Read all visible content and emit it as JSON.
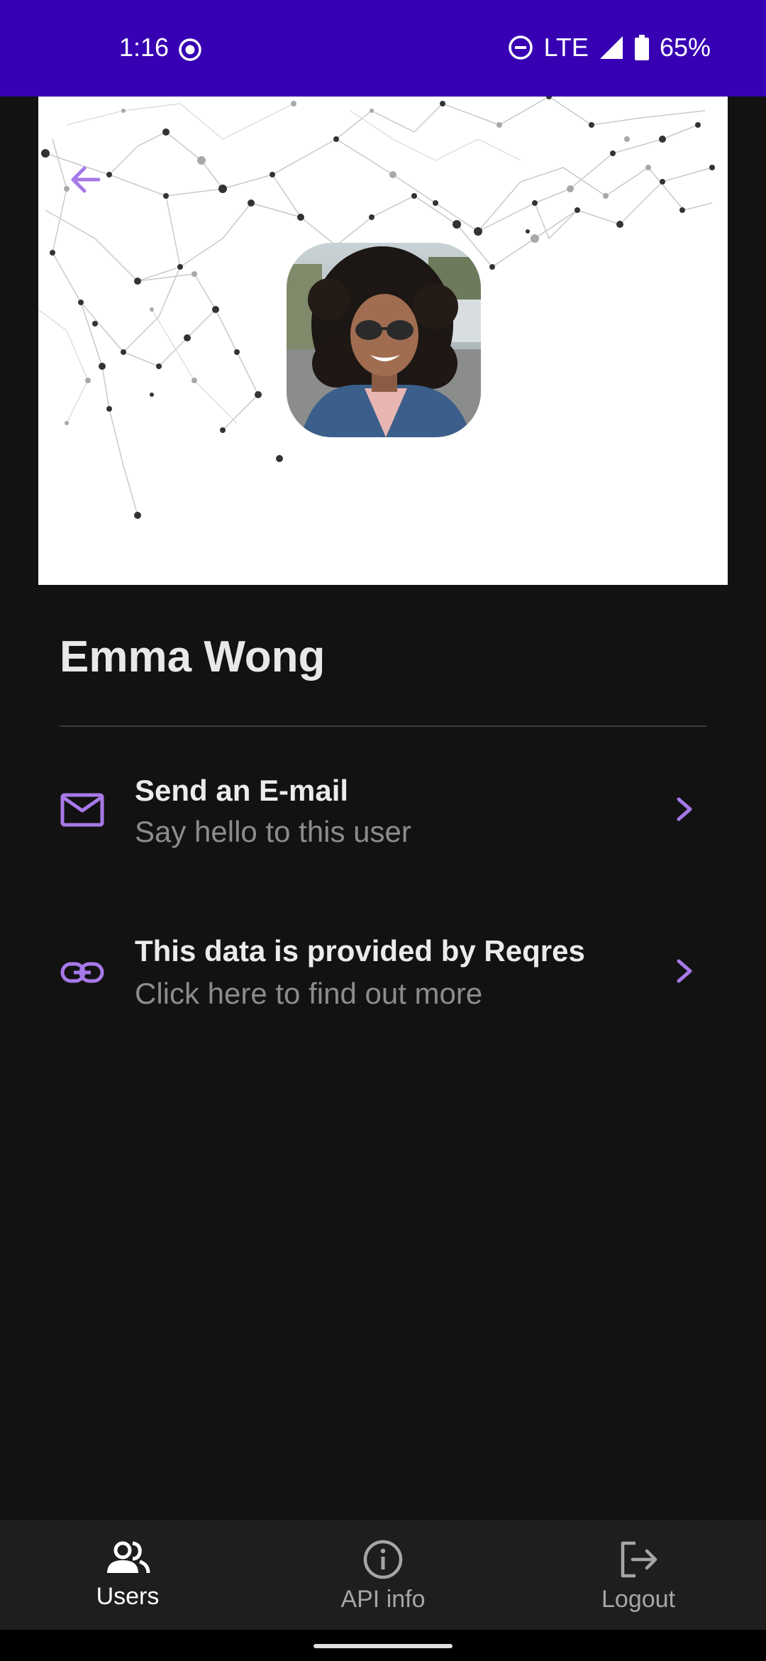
{
  "status_bar": {
    "time": "1:16",
    "network": "LTE",
    "battery": "65%",
    "icons": [
      "screen-record-icon",
      "do-not-disturb-icon",
      "signal-icon",
      "battery-icon"
    ]
  },
  "header": {
    "back_icon": "arrow-left-icon",
    "accent_color": "#a779e9"
  },
  "user": {
    "name": "Emma Wong"
  },
  "actions": [
    {
      "icon": "mail-icon",
      "title": "Send an E-mail",
      "subtitle": "Say hello to this user"
    },
    {
      "icon": "link-icon",
      "title": "This data is provided by Reqres",
      "subtitle": "Click here to find out more"
    }
  ],
  "bottom_nav": {
    "items": [
      {
        "icon": "users-icon",
        "label": "Users",
        "active": true
      },
      {
        "icon": "info-icon",
        "label": "API info",
        "active": false
      },
      {
        "icon": "logout-icon",
        "label": "Logout",
        "active": false
      }
    ]
  },
  "colors": {
    "status_bar": "#3700b3",
    "background": "#121212",
    "accent": "#a779e9",
    "nav_background": "#1e1e1e"
  }
}
